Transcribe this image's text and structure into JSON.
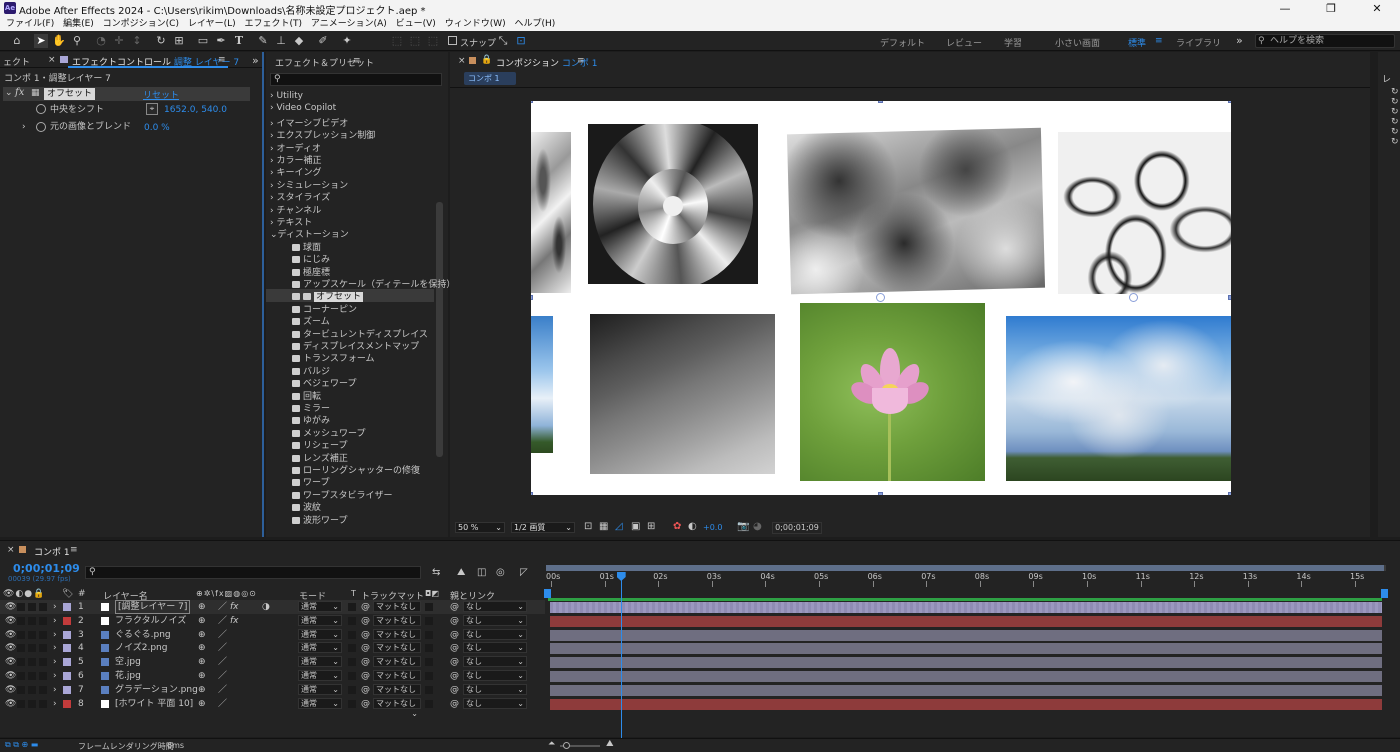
{
  "window": {
    "title": "Adobe After Effects 2024 - C:\\Users\\rikim\\Downloads\\名称未設定プロジェクト.aep *",
    "app_icon": "Ae"
  },
  "menu": [
    "ファイル(F)",
    "編集(E)",
    "コンポジション(C)",
    "レイヤー(L)",
    "エフェクト(T)",
    "アニメーション(A)",
    "ビュー(V)",
    "ウィンドウ(W)",
    "ヘルプ(H)"
  ],
  "toolbar": {
    "snap_label": "スナップ",
    "workspaces": [
      "デフォルト",
      "レビュー",
      "学習",
      "小さい画面",
      "標準",
      "ライブラリ"
    ],
    "active_workspace": "標準",
    "help_placeholder": "ヘルプを検索"
  },
  "effect_controls": {
    "partial_tab": "ェクト",
    "tab_label": "エフェクトコントロール",
    "tab_target": "調整 レイヤー 7",
    "breadcrumb": "コンポ 1・調整レイヤー 7",
    "effect_name": "オフセット",
    "reset_label": "リセット",
    "props": [
      {
        "label": "中央をシフト",
        "value": "1652.0, 540.0"
      },
      {
        "label": "元の画像とブレンド",
        "value": "0.0 %"
      }
    ]
  },
  "effects_presets": {
    "title": "エフェクト＆プリセット",
    "categories": [
      "Utility",
      "Video Copilot",
      "イマーシブビデオ",
      "エクスプレッション制御",
      "オーディオ",
      "カラー補正",
      "キーイング",
      "シミュレーション",
      "スタイライズ",
      "チャンネル",
      "テキスト"
    ],
    "open_category": "ディストーション",
    "items": [
      "球面",
      "にじみ",
      "極座標",
      "アップスケール（ディテールを保持）",
      "オフセット",
      "コーナーピン",
      "ズーム",
      "タービュレントディスプレイス",
      "ディスプレイスメントマップ",
      "トランスフォーム",
      "バルジ",
      "ベジェワープ",
      "回転",
      "ミラー",
      "ゆがみ",
      "メッシュワープ",
      "リシェープ",
      "レンズ補正",
      "ローリングシャッターの修復",
      "ワープ",
      "ワープスタビライザー",
      "波紋",
      "波形ワープ"
    ],
    "selected_item": "オフセット"
  },
  "composition": {
    "tab_prefix": "コンポジション",
    "tab_name": "コンポ 1",
    "subtab": "コンポ 1",
    "zoom": "50 %",
    "resolution": "1/2 画質",
    "exposure": "+0.0",
    "timecode": "0;00;01;09"
  },
  "timeline": {
    "comp_tab": "コンポ 1",
    "timecode": "0;00;01;09",
    "frame_info": "00039 (29.97 fps)",
    "col_headers": {
      "layer_name": "レイヤー名",
      "mode": "モード",
      "trackmatte": "トラックマット",
      "parent": "親とリンク"
    },
    "ticks": [
      "00s",
      "01s",
      "02s",
      "03s",
      "04s",
      "05s",
      "06s",
      "07s",
      "08s",
      "09s",
      "10s",
      "11s",
      "12s",
      "13s",
      "14s",
      "15s"
    ],
    "playhead_seconds": 1.3,
    "duration_seconds": 15.5,
    "layers": [
      {
        "num": "1",
        "name": "[調整レイヤー 7]",
        "mode": "通常",
        "matte": "マットなし",
        "parent": "なし",
        "color": "#a9a6d6",
        "bar": "#8f8cb3",
        "fx": true
      },
      {
        "num": "2",
        "name": "フラクタルノイズ",
        "mode": "通常",
        "matte": "マットなし",
        "parent": "なし",
        "color": "#c23b3b",
        "bar": "#8e3b3b",
        "fx": true
      },
      {
        "num": "3",
        "name": "ぐるぐる.png",
        "mode": "通常",
        "matte": "マットなし",
        "parent": "なし",
        "color": "#a9a6d6",
        "bar": "#6f6e80",
        "fx": false
      },
      {
        "num": "4",
        "name": "ノイズ2.png",
        "mode": "通常",
        "matte": "マットなし",
        "parent": "なし",
        "color": "#a9a6d6",
        "bar": "#6f6e80",
        "fx": false
      },
      {
        "num": "5",
        "name": "空.jpg",
        "mode": "通常",
        "matte": "マットなし",
        "parent": "なし",
        "color": "#a9a6d6",
        "bar": "#6f6e80",
        "fx": false
      },
      {
        "num": "6",
        "name": "花.jpg",
        "mode": "通常",
        "matte": "マットなし",
        "parent": "なし",
        "color": "#a9a6d6",
        "bar": "#6f6e80",
        "fx": false
      },
      {
        "num": "7",
        "name": "グラデーション.png",
        "mode": "通常",
        "matte": "マットなし",
        "parent": "なし",
        "color": "#a9a6d6",
        "bar": "#6f6e80",
        "fx": false
      },
      {
        "num": "8",
        "name": "[ホワイト 平面 10]",
        "mode": "通常",
        "matte": "マットなし",
        "parent": "なし",
        "color": "#c23b3b",
        "bar": "#8e3b3b",
        "fx": false
      }
    ],
    "render_time_label": "フレームレンダリング時間",
    "render_time_value": "6ms"
  },
  "colors": {
    "accent": "#2d8ceb",
    "panel": "#232323",
    "bg": "#1d1d1d",
    "playhead": "#2d8ceb"
  }
}
